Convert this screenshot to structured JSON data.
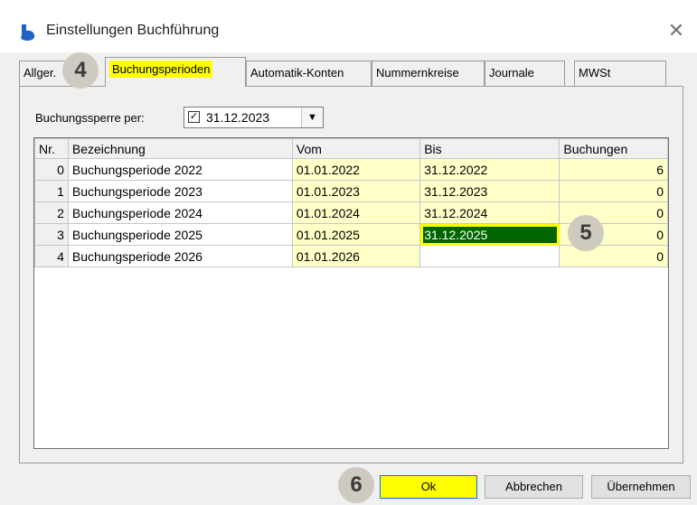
{
  "window": {
    "title": "Einstellungen Buchführung"
  },
  "tabs": [
    {
      "label": "Allger."
    },
    {
      "label": "Buchungsperioden"
    },
    {
      "label": "Automatik-Konten"
    },
    {
      "label": "Nummernkreise"
    },
    {
      "label": "Journale"
    },
    {
      "label": "MWSt"
    }
  ],
  "lock": {
    "label": "Buchungssperre per:",
    "checked": true,
    "date": "31.12.2023"
  },
  "grid": {
    "headers": [
      "Nr.",
      "Bezeichnung",
      "Vom",
      "Bis",
      "Buchungen"
    ],
    "rows": [
      {
        "nr": "0",
        "name": "Buchungsperiode 2022",
        "from": "01.01.2022",
        "to": "31.12.2022",
        "count": "6"
      },
      {
        "nr": "1",
        "name": "Buchungsperiode 2023",
        "from": "01.01.2023",
        "to": "31.12.2023",
        "count": "0"
      },
      {
        "nr": "2",
        "name": "Buchungsperiode 2024",
        "from": "01.01.2024",
        "to": "31.12.2024",
        "count": "0"
      },
      {
        "nr": "3",
        "name": "Buchungsperiode 2025",
        "from": "01.01.2025",
        "to": "31.12.2025",
        "count": "0"
      },
      {
        "nr": "4",
        "name": "Buchungsperiode 2026",
        "from": "01.01.2026",
        "to": "",
        "count": "0"
      }
    ]
  },
  "badges": {
    "tab": "4",
    "cell": "5",
    "ok": "6"
  },
  "buttons": {
    "ok": "Ok",
    "cancel": "Abbrechen",
    "apply": "Übernehmen"
  },
  "colors": {
    "highlight": "#ffff00",
    "selected_cell": "#006400",
    "date_cells": "#ffffc8"
  }
}
